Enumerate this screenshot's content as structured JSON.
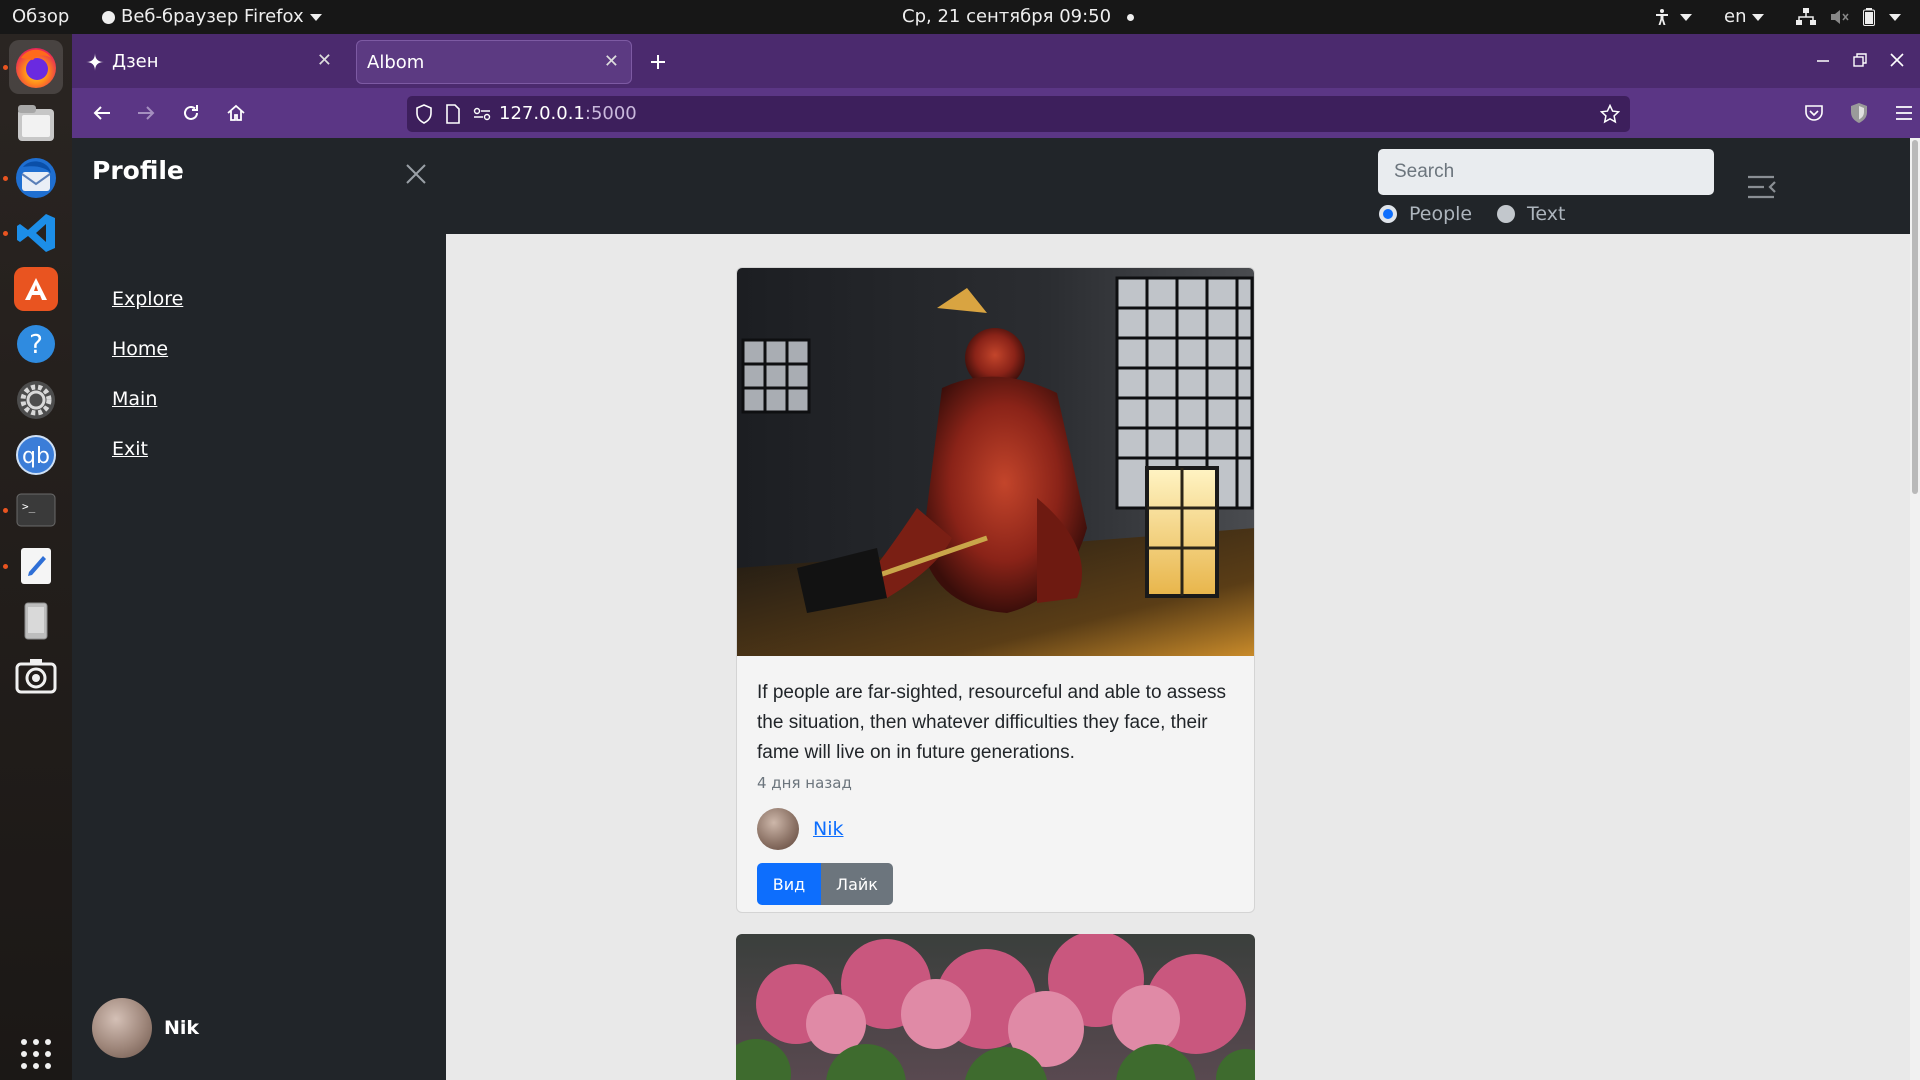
{
  "topbar": {
    "activities": "Обзор",
    "app_menu": "Веб-браузер Firefox",
    "clock": "Ср, 21 сентября  09:50",
    "lang": "en"
  },
  "dock": {
    "items": [
      "firefox",
      "files",
      "thunderbird",
      "vscode",
      "app-center",
      "help",
      "settings",
      "qbittorrent",
      "terminal",
      "text-editor",
      "removable-drive",
      "screenshot",
      "show-apps"
    ]
  },
  "browser": {
    "tabs": [
      {
        "label": "Дзен",
        "active": false
      },
      {
        "label": "Albom",
        "active": true
      }
    ],
    "url_host": "127.0.0.1",
    "url_port": ":5000"
  },
  "offcanvas": {
    "title": "Profile",
    "links": [
      "Explore",
      "Home",
      "Main",
      "Exit"
    ],
    "user_name": "Nik"
  },
  "navbar": {
    "search_placeholder": "Search",
    "radio_people": "People",
    "radio_text": "Text",
    "selected": "People"
  },
  "post": {
    "text": "If people are far-sighted, resourceful and able to assess the situation, then whatever difficulties they face, their fame will live on in future generations.",
    "time": "4 дня назад",
    "author": "Nik",
    "view_label": "Вид",
    "like_label": "Лайк"
  },
  "colors": {
    "tabstrip": "#4b2a6e",
    "navbar": "#5b3685",
    "dark": "#212529",
    "primary": "#0d6efd",
    "secondary": "#6c757d"
  }
}
